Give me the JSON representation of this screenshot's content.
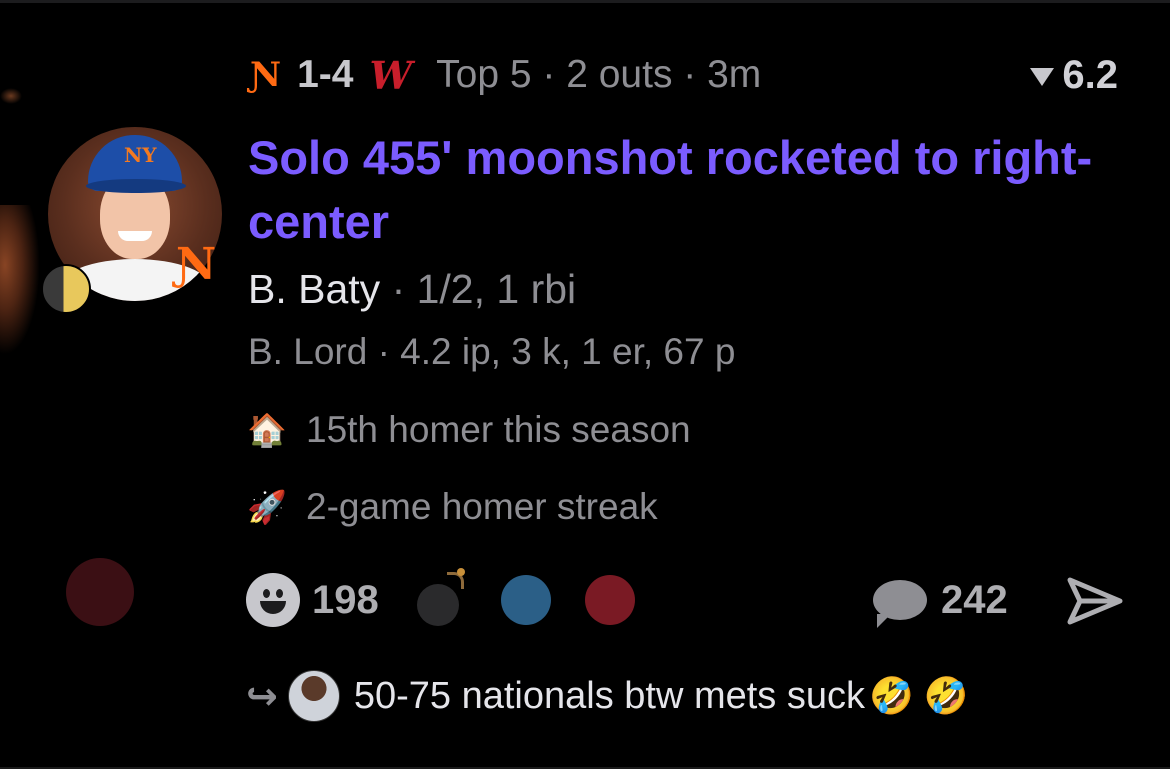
{
  "game": {
    "away_team_icon": "mets-logo-icon",
    "away_logo_glyph": "Ɲ",
    "score": "1-4",
    "home_team_icon": "nationals-logo-icon",
    "home_logo_glyph": "W",
    "status": "Top 5 · 2 outs · 3m"
  },
  "rating": {
    "icon": "triangle-down-icon",
    "value": "6.2"
  },
  "play": {
    "headline": "Solo 455' moonshot rocketed to right-center"
  },
  "batter": {
    "name": "B. Baty",
    "separator": " · ",
    "stats": "1/2, 1 rbi"
  },
  "pitcher": {
    "line": "B. Lord · 4.2 ip, 3 k, 1 er, 67 p"
  },
  "avatar": {
    "badge_glyph": "Ɲ",
    "badge_icon": "mets-badge-icon",
    "status_icon": "moon-icon"
  },
  "notes": [
    {
      "icon": "house-icon",
      "emoji": "🏠",
      "text": "15th homer this season"
    },
    {
      "icon": "rocket-icon",
      "emoji": "🚀",
      "text": "2-game homer streak"
    }
  ],
  "reactions": {
    "icon": "smiley-icon",
    "count": "198",
    "extra_icons": [
      "bomb-icon",
      "blue-dot-icon",
      "red-dot-icon"
    ]
  },
  "comments": {
    "icon": "chat-bubble-icon",
    "count": "242"
  },
  "share": {
    "icon": "send-icon"
  },
  "reply_preview": {
    "icon": "reply-arrow-icon",
    "arrow": "↪",
    "text": "50-75 nationals btw mets suck",
    "emoji": "🤣 🤣"
  },
  "colors": {
    "background": "#000000",
    "headline": "#7b5cff",
    "mets_orange": "#ff6a13",
    "nationals_red": "#c81e2b",
    "muted": "#8e8e93"
  }
}
